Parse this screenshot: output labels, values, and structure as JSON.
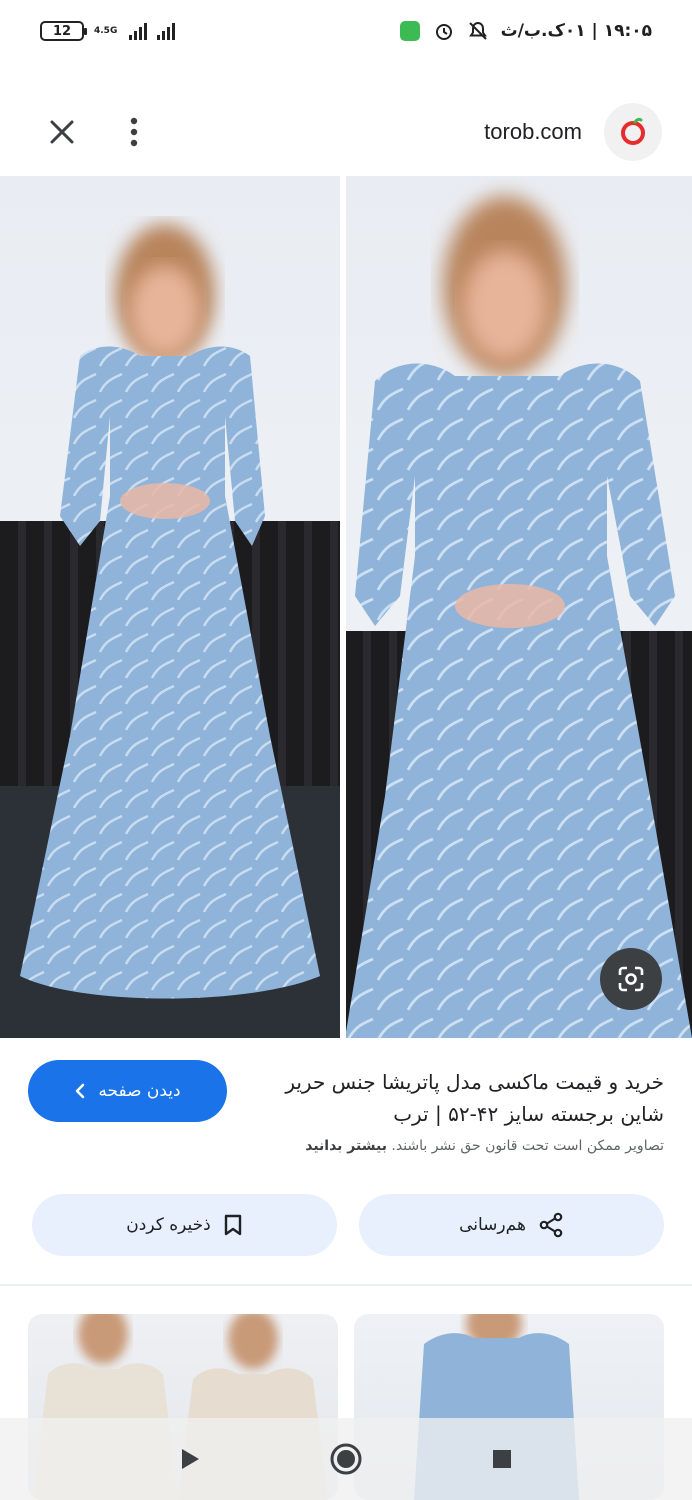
{
  "status_bar": {
    "battery": "12",
    "network": "4.5G",
    "time_date": "۱۹:۰۵ | ۰۱ک.ب/ث",
    "icons": [
      "battery-icon",
      "signal-icon",
      "green-app-icon",
      "alarm-icon",
      "mute-icon"
    ]
  },
  "header": {
    "domain": "torob.com",
    "icons": [
      "close-icon",
      "more-vert-icon",
      "torob-logo"
    ]
  },
  "image": {
    "icons": [
      "google-lens-icon"
    ],
    "colors": {
      "dress": "#8fb3d9",
      "curtain": "#1c1c1f",
      "backdrop": "#e9edf3"
    }
  },
  "result": {
    "title": "خرید و قیمت ماکسی مدل پاتریشا جنس حریر شاین برجسته سایز ۴۲-۵۲ | ترب",
    "visit_label": "دیدن صفحه",
    "copyright_text": "تصاویر ممکن است تحت قانون حق نشر باشند.",
    "learn_more": "بیشتر بدانید",
    "accent_color": "#1a73e8"
  },
  "actions": {
    "share_label": "هم‌رسانی",
    "save_label": "ذخیره کردن"
  },
  "nav": {
    "icons": [
      "back-triangle-icon",
      "home-circle-icon",
      "recents-square-icon"
    ]
  }
}
